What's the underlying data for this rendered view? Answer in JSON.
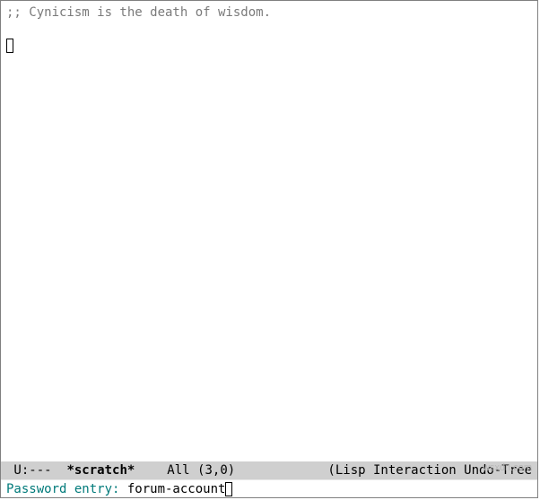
{
  "buffer": {
    "comment": ";; Cynicism is the death of wisdom."
  },
  "modeline": {
    "status": " U:---  ",
    "buffer_name": "*scratch*",
    "position": "All",
    "cursor": "(3,0)",
    "modes": "(Lisp Interaction Undo-Tree"
  },
  "minibuffer": {
    "prompt": "Password entry: ",
    "value": "forum-account"
  },
  "watermark": "wsxdn.com"
}
